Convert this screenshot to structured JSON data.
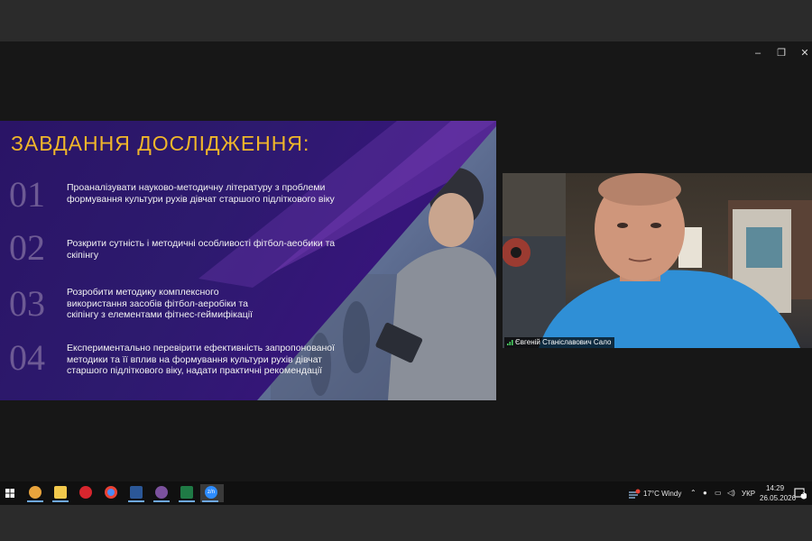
{
  "slide": {
    "title": "ЗАВДАННЯ ДОСЛІДЖЕННЯ:",
    "items": [
      {
        "num": "01",
        "text": "Проаналізувати науково-методичну літературу з проблеми формування культури рухів дівчат старшого підліткового віку"
      },
      {
        "num": "02",
        "text": "Розкрити сутність і методичні особливості фітбол-аеобики та скіпінгу"
      },
      {
        "num": "03",
        "text": "Розробити методику комплексного використання засобів фітбол-аеробіки та скіпінгу з елементами фітнес-геймифікації"
      },
      {
        "num": "04",
        "text": "Експериментально перевірити ефективність запропонованої методики та її вплив на формування культури рухів дівчат старшого підліткового віку, надати практичні рекомендації"
      }
    ]
  },
  "video": {
    "participant_name": "Євгеній Станіславович Сало"
  },
  "window_controls": {
    "minimize": "–",
    "maximize": "❐",
    "close": "✕"
  },
  "taskbar": {
    "apps": [
      {
        "name": "start-button",
        "icon": "windows-icon"
      },
      {
        "name": "chrome-canary",
        "icon": "chrome-icon",
        "color": "#e8a33c"
      },
      {
        "name": "file-explorer",
        "icon": "folder-icon",
        "color": "#f2c94c"
      },
      {
        "name": "opera",
        "icon": "opera-icon",
        "color": "#d7262e"
      },
      {
        "name": "chrome",
        "icon": "chrome-icon",
        "color": "#4c8bf5"
      },
      {
        "name": "word",
        "icon": "word-icon",
        "color": "#2b5797"
      },
      {
        "name": "viber",
        "icon": "viber-icon",
        "color": "#7b519d"
      },
      {
        "name": "excel",
        "icon": "excel-icon",
        "color": "#1f7a45"
      },
      {
        "name": "zoom",
        "icon": "zoom-icon",
        "color": "#2d8cff"
      }
    ],
    "zoom_label": "z/n",
    "weather": "17°C  Windy",
    "language": "УКР",
    "time": "14:29",
    "date": "26.05.2026",
    "notification_count": "2"
  }
}
